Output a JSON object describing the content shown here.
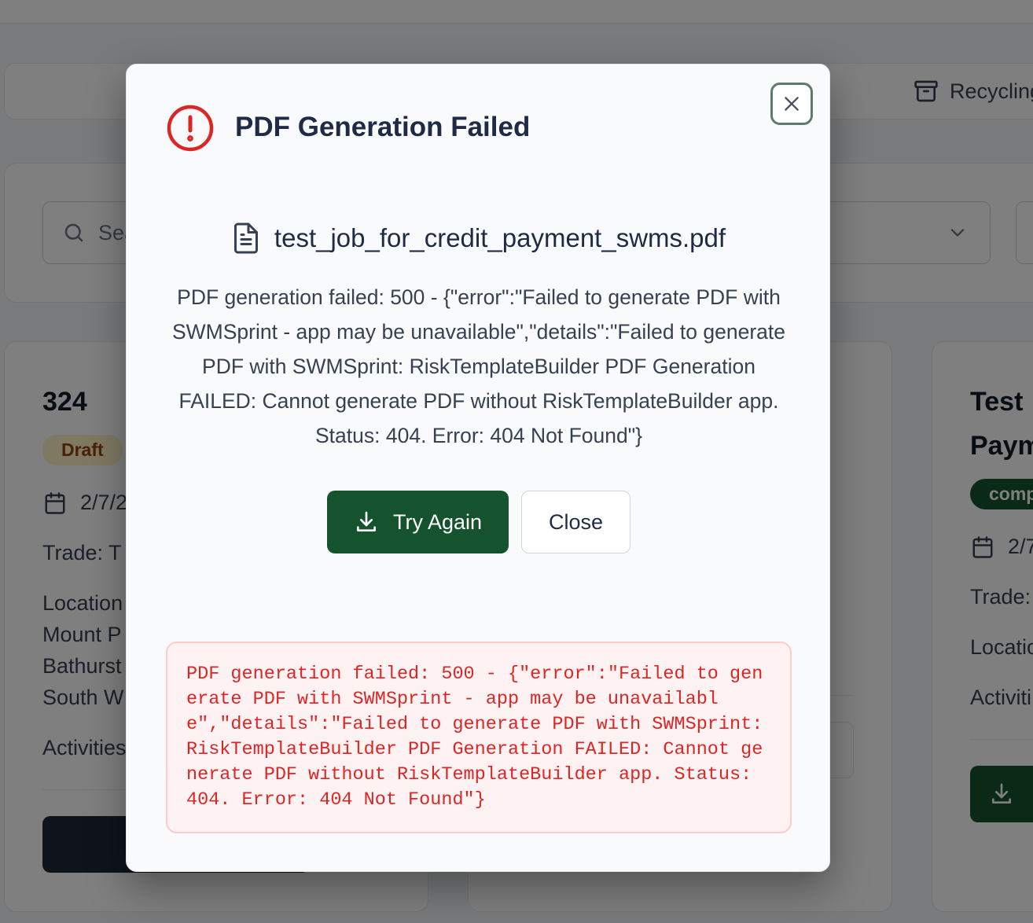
{
  "background": {
    "recycling_label": "Recycling",
    "search_placeholder": "Search",
    "cards": [
      {
        "title": "324",
        "status": "Draft",
        "date": "2/7/2",
        "trade": "Trade: T",
        "location_lines": [
          "Location",
          "Mount P",
          "Bathurst",
          "South W"
        ],
        "activities": "Activities"
      },
      {
        "title_lines": [
          "Test",
          "Paym"
        ],
        "status": "comp",
        "date": "2/7",
        "trade": "Trade:",
        "location": "Locatio",
        "activities": "Activiti"
      }
    ]
  },
  "modal": {
    "title": "PDF Generation Failed",
    "file_name": "test_job_for_credit_payment_swms.pdf",
    "message": "PDF generation failed: 500 - {\"error\":\"Failed to generate PDF with SWMSprint - app may be unavailable\",\"details\":\"Failed to generate PDF with SWMSprint: RiskTemplateBuilder PDF Generation FAILED: Cannot generate PDF without RiskTemplateBuilder app. Status: 404. Error: 404 Not Found\"}",
    "try_again_label": "Try Again",
    "close_label": "Close",
    "error_detail": "PDF generation failed: 500 - {\"error\":\"Failed to generate PDF with SWMSprint - app may be unavailable\",\"details\":\"Failed to generate PDF with SWMSprint: RiskTemplateBuilder PDF Generation FAILED: Cannot generate PDF without RiskTemplateBuilder app. Status: 404. Error: 404 Not Found\"}"
  },
  "colors": {
    "primary": "#14532d",
    "error": "#dc2626",
    "error_bg": "#fef2f2"
  }
}
